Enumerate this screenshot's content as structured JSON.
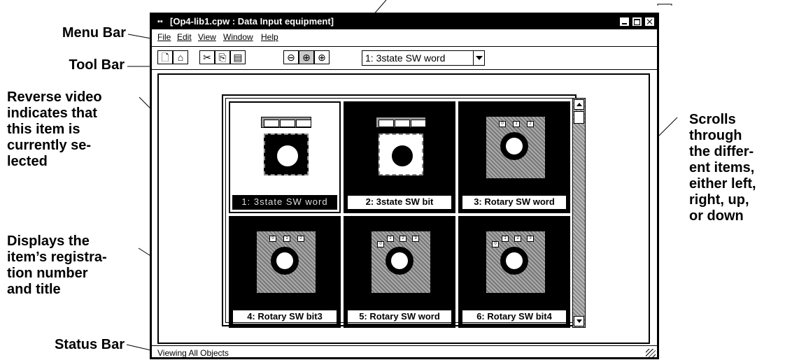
{
  "annotations": {
    "menu_bar": "Menu Bar",
    "tool_bar": "Tool Bar",
    "reverse_video": [
      "Reverse video",
      "indicates that",
      "this item is",
      "currently se-",
      "lected"
    ],
    "displays": [
      "Displays the",
      "item’s registra-",
      "tion number",
      "and title"
    ],
    "scrolls": [
      "Scrolls",
      "through",
      "the differ-",
      "ent items,",
      "either left,",
      "right, up,",
      "or down"
    ],
    "status_bar": "Status Bar"
  },
  "window": {
    "title": "[Op4-lib1.cpw : Data Input equipment]",
    "menu": [
      "File",
      "Edit",
      "View",
      "Window",
      "Help"
    ],
    "toolbar": {
      "icons": [
        "new-file-icon",
        "open-folder-icon",
        "cut-icon",
        "copy-icon",
        "paste-icon",
        "zoom-out-icon",
        "zoom-normal-icon",
        "zoom-in-icon"
      ],
      "item_select": "1: 3state SW word"
    },
    "items": [
      {
        "label": "1: 3state SW word",
        "selected": true,
        "icon": "three-state-switch-icon"
      },
      {
        "label": "2: 3state SW bit",
        "selected": false,
        "icon": "three-state-switch-icon"
      },
      {
        "label": "3: Rotary SW word",
        "selected": false,
        "icon": "rotary-switch-icon"
      },
      {
        "label": "4: Rotary SW bit3",
        "selected": false,
        "icon": "rotary-switch-icon"
      },
      {
        "label": "5: Rotary SW word",
        "selected": false,
        "icon": "rotary-switch-icon"
      },
      {
        "label": "6: Rotary SW bit4",
        "selected": false,
        "icon": "rotary-switch-icon"
      }
    ],
    "status": "Viewing All Objects"
  }
}
